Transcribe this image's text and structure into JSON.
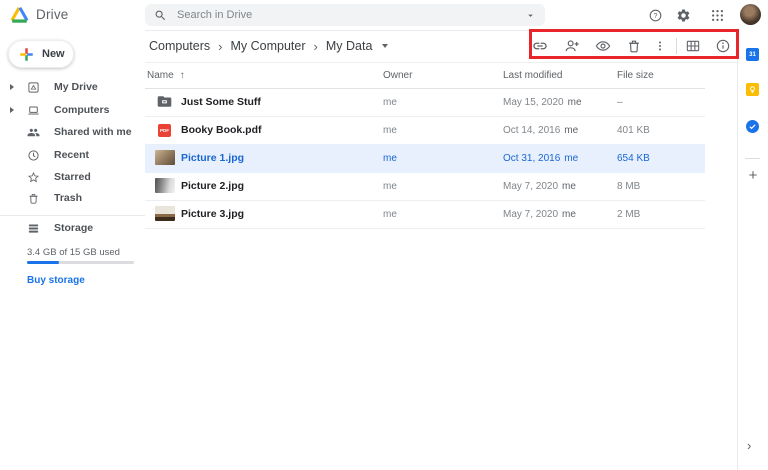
{
  "topbar": {
    "app_name": "Drive",
    "search": {
      "placeholder": "Search in Drive"
    }
  },
  "sidebar": {
    "new_button_label": "New",
    "items": [
      {
        "label": "My Drive",
        "icon": "my-drive-icon",
        "expandable": true
      },
      {
        "label": "Computers",
        "icon": "computers-icon",
        "expandable": true
      },
      {
        "label": "Shared with me",
        "icon": "shared-icon",
        "expandable": false
      },
      {
        "label": "Recent",
        "icon": "recent-icon",
        "expandable": false
      },
      {
        "label": "Starred",
        "icon": "starred-icon",
        "expandable": false
      },
      {
        "label": "Trash",
        "icon": "trash-icon",
        "expandable": false
      }
    ],
    "storage": {
      "label": "Storage",
      "usage": "3.4 GB of 15 GB used",
      "percent_used": 30,
      "buy_label": "Buy storage"
    }
  },
  "breadcrumb": {
    "items": [
      "Computers",
      "My Computer",
      "My Data"
    ],
    "separator": "›"
  },
  "toolbar": {
    "icons": [
      "get-link",
      "add-collaborator",
      "preview",
      "delete",
      "more-actions",
      "grid-view",
      "view-details"
    ],
    "highlight_color": "#e8252a"
  },
  "table": {
    "columns": [
      "Name",
      "Owner",
      "Last modified",
      "File size"
    ],
    "sort_indicator": "↑",
    "rows": [
      {
        "name": "Just Some Stuff",
        "type": "folder",
        "owner": "me",
        "modified": "May 15, 2020",
        "modified_by": "me",
        "size": "–",
        "selected": false
      },
      {
        "name": "Booky Book.pdf",
        "type": "pdf",
        "icon_label": "PDF",
        "owner": "me",
        "modified": "Oct 14, 2016",
        "modified_by": "me",
        "size": "401 KB",
        "selected": false
      },
      {
        "name": "Picture 1.jpg",
        "type": "image",
        "owner": "me",
        "modified": "Oct 31, 2016",
        "modified_by": "me",
        "size": "654 KB",
        "selected": true
      },
      {
        "name": "Picture 2.jpg",
        "type": "image",
        "owner": "me",
        "modified": "May 7, 2020",
        "modified_by": "me",
        "size": "8 MB",
        "selected": false
      },
      {
        "name": "Picture 3.jpg",
        "type": "image",
        "owner": "me",
        "modified": "May 7, 2020",
        "modified_by": "me",
        "size": "2 MB",
        "selected": false
      }
    ]
  },
  "side_panel": {
    "calendar_day": "31",
    "icons": [
      "calendar",
      "keep",
      "tasks",
      "get-add-ons"
    ],
    "collapse_chevron": "›"
  },
  "colors": {
    "accent_blue": "#1a73e8",
    "selection_bg": "#e8f0fe",
    "selection_text": "#1967d2",
    "highlight_red": "#e8252a",
    "pdf_red": "#ea4335",
    "icon_gray": "#5f6368"
  }
}
